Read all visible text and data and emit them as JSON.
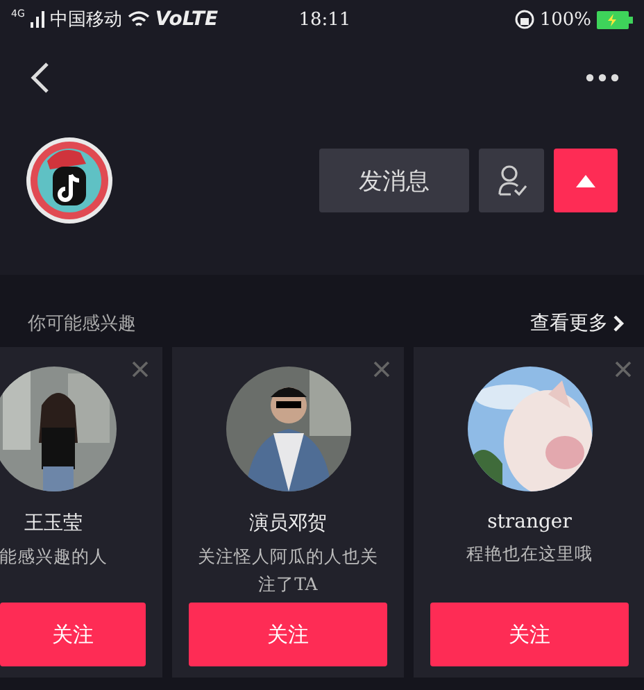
{
  "status_bar": {
    "network": "4G",
    "carrier": "中国移动",
    "volte": "VoLTE",
    "time": "18:11",
    "battery": "100%"
  },
  "profile": {
    "actions": [
      {
        "kind": "message",
        "label": "发消息"
      },
      {
        "kind": "friend"
      },
      {
        "kind": "collapse"
      }
    ]
  },
  "suggestions": {
    "title": "你可能感兴趣",
    "more": "查看更多",
    "cards": [
      {
        "kind": "partial",
        "name": "王玉莹",
        "reason": "能感兴趣的人",
        "follow": "关注"
      },
      {
        "kind": "full",
        "name": "演员邓贺",
        "reason": "关注怪人阿瓜的人也关注了TA",
        "follow": "关注"
      },
      {
        "kind": "full",
        "name": "stranger",
        "reason": "程艳也在这里哦",
        "follow": "关注"
      }
    ]
  }
}
